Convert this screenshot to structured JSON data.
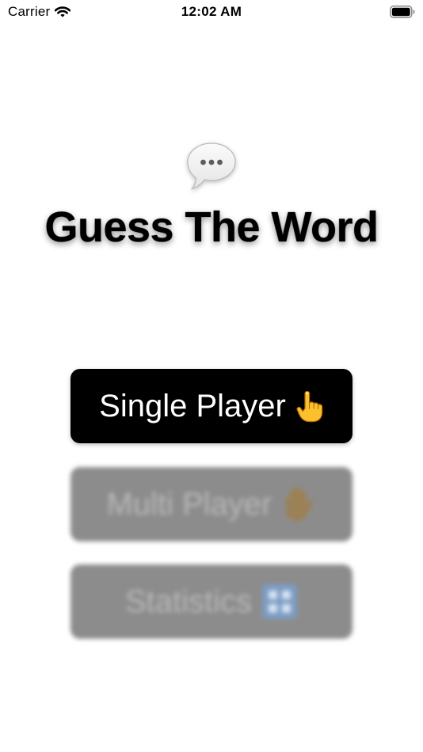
{
  "status_bar": {
    "carrier": "Carrier",
    "time": "12:02 AM",
    "icons": [
      "wifi-icon",
      "battery-icon"
    ]
  },
  "header": {
    "icon": "speech-bubble-icon",
    "title": "Guess The Word"
  },
  "menu": {
    "single_player": {
      "label": "Single Player",
      "icon": "pointing-up-hand-icon",
      "background": "#000000",
      "text_color": "#ffffff"
    },
    "multi_player": {
      "label": "Multi Player",
      "icon": "raised-hand-icon",
      "state": "blurred"
    },
    "statistics": {
      "label": "Statistics",
      "icon": "numbers-icon",
      "state": "blurred"
    }
  },
  "colors": {
    "background": "#ffffff",
    "primary_button": "#000000",
    "disabled_button": "#8c8c8c",
    "disabled_text": "#b9b9b9"
  }
}
